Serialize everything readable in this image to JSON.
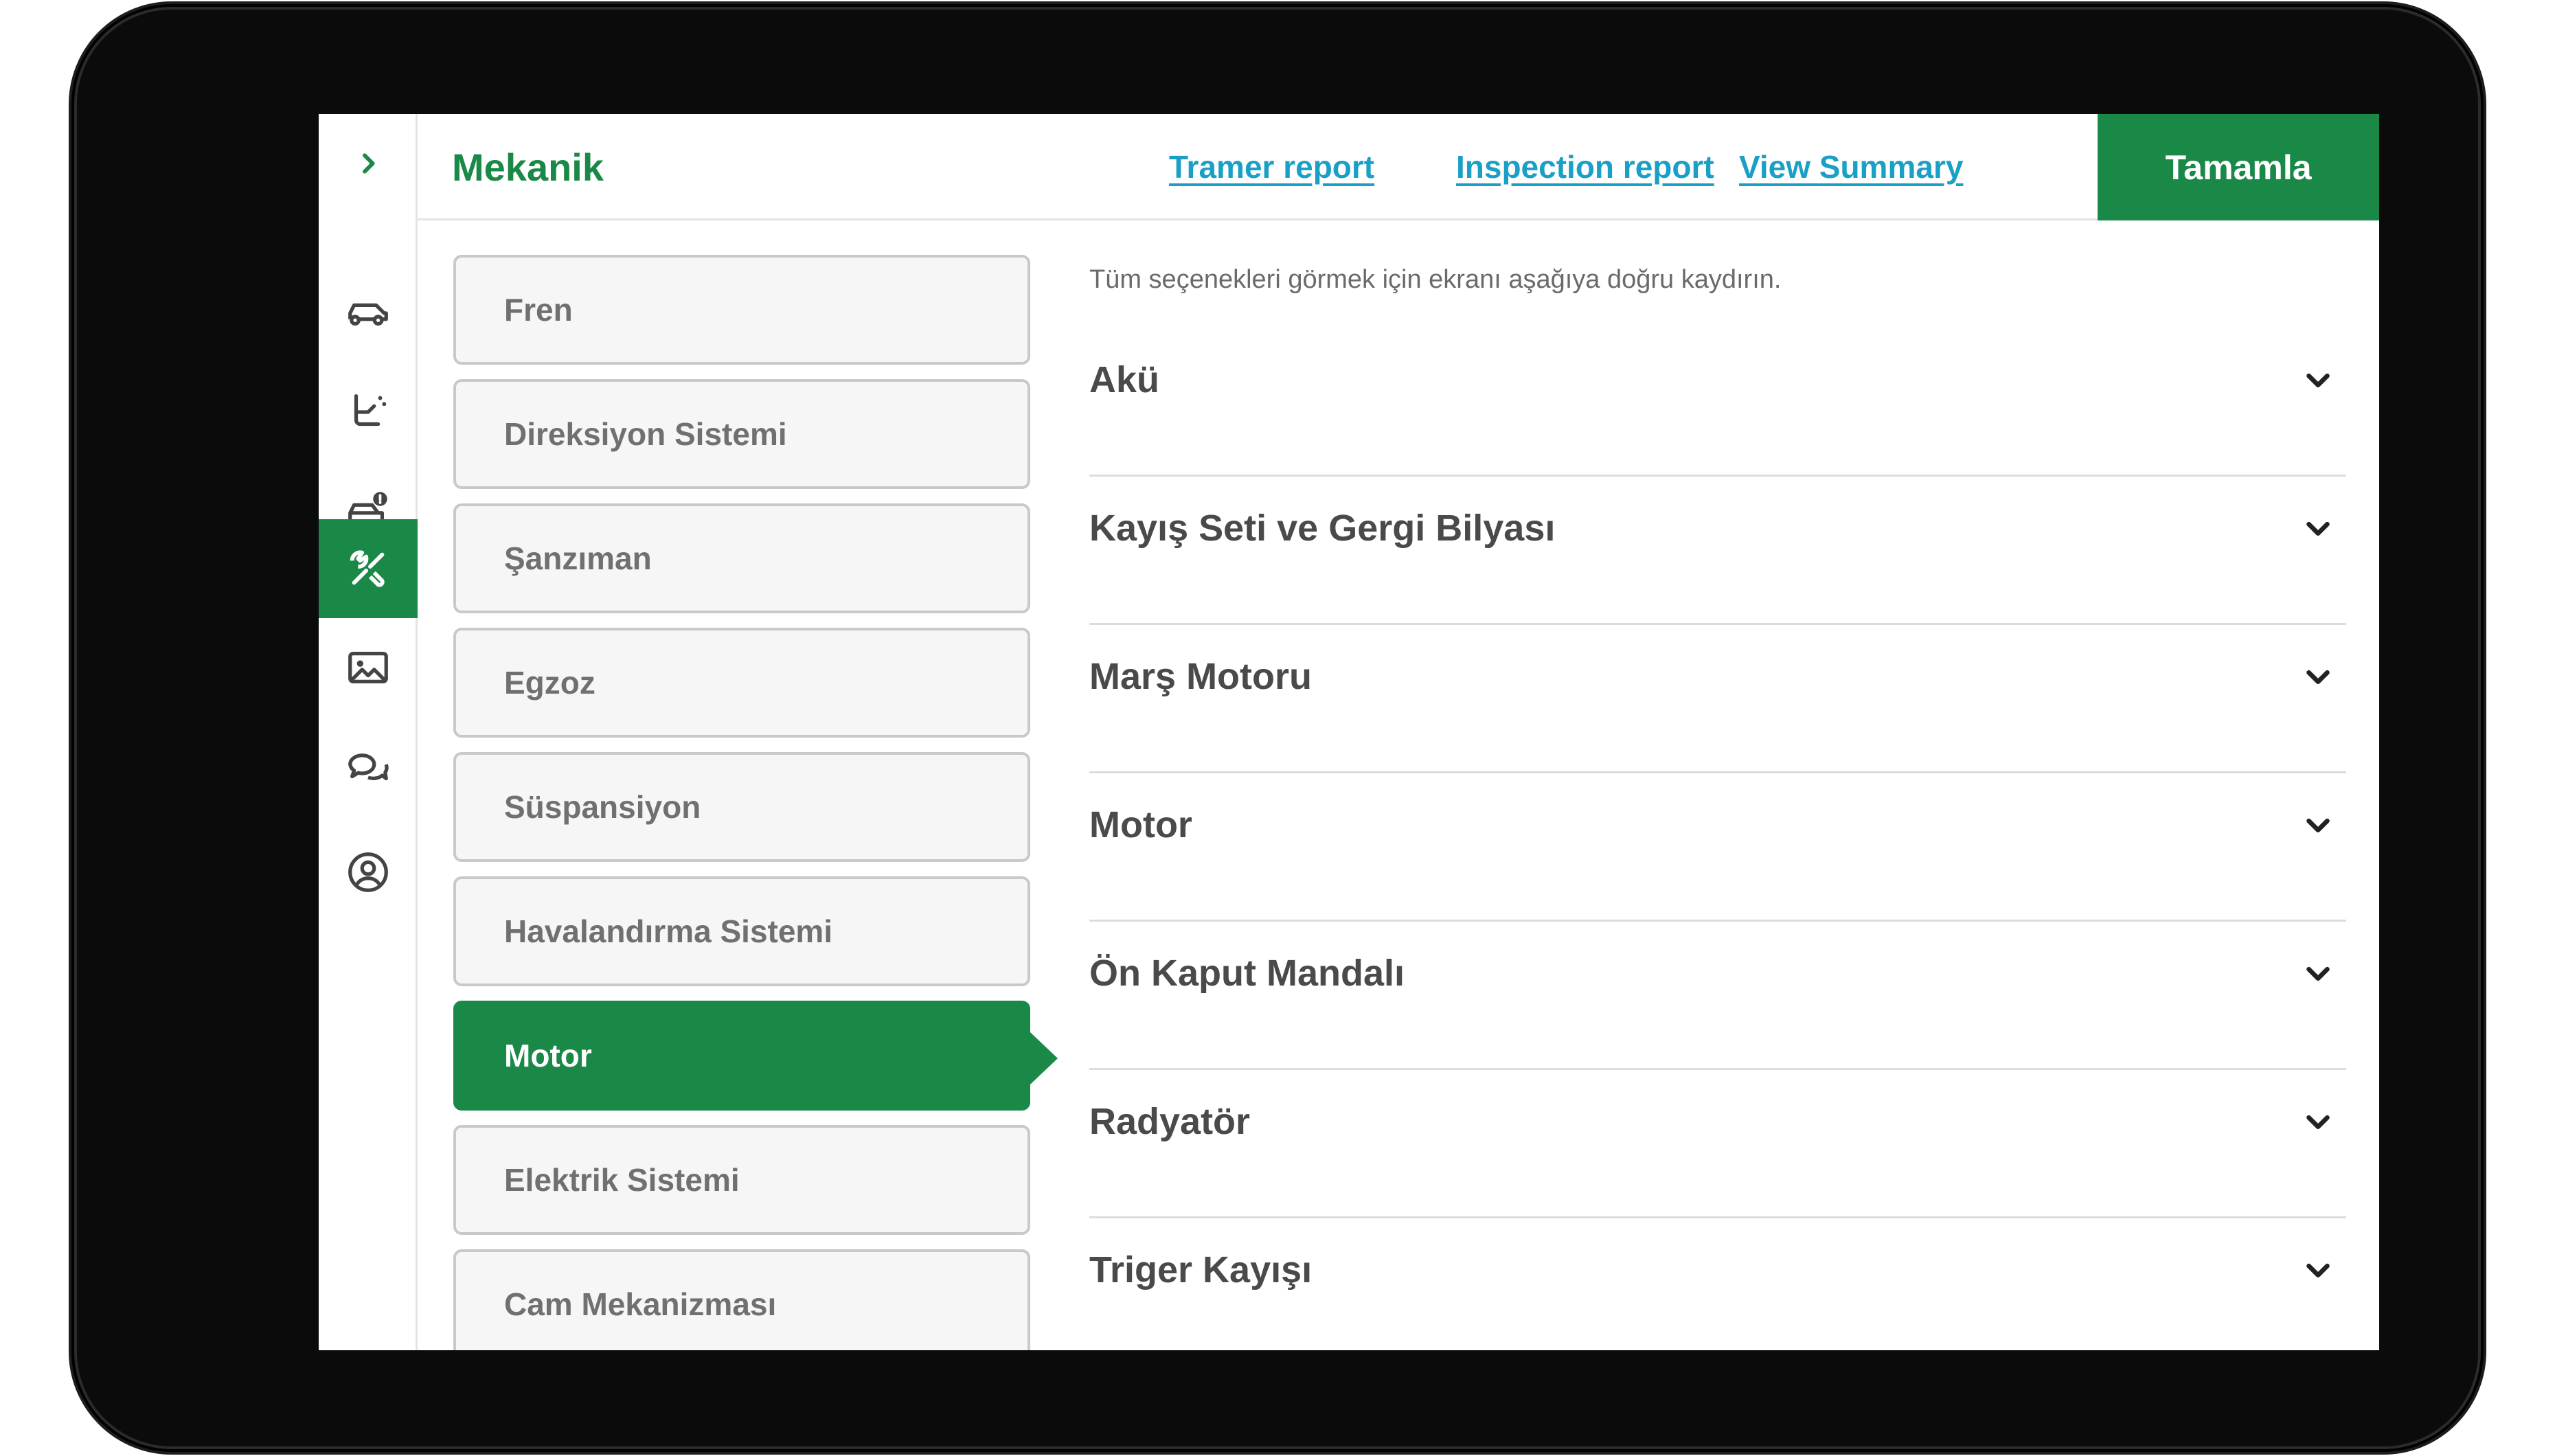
{
  "header": {
    "title": "Mekanik",
    "links": [
      "Tramer report",
      "Inspection report",
      "View Summary"
    ],
    "complete_label": "Tamamla"
  },
  "rail": {
    "expand_icon": "chevron-right-icon",
    "items": [
      {
        "icon": "car-icon",
        "active": false
      },
      {
        "icon": "car-seat-icon",
        "active": false
      },
      {
        "icon": "car-warning-icon",
        "active": false
      },
      {
        "icon": "tools-icon",
        "active": true
      },
      {
        "icon": "image-icon",
        "active": false
      },
      {
        "icon": "chat-icon",
        "active": false
      },
      {
        "icon": "user-icon",
        "active": false
      }
    ]
  },
  "categories": [
    {
      "label": "Fren",
      "active": false
    },
    {
      "label": "Direksiyon Sistemi",
      "active": false
    },
    {
      "label": "Şanzıman",
      "active": false
    },
    {
      "label": "Egzoz",
      "active": false
    },
    {
      "label": "Süspansiyon",
      "active": false
    },
    {
      "label": "Havalandırma Sistemi",
      "active": false
    },
    {
      "label": "Motor",
      "active": true
    },
    {
      "label": "Elektrik Sistemi",
      "active": false
    },
    {
      "label": "Cam Mekanizması",
      "active": false
    }
  ],
  "content": {
    "hint": "Tüm seçenekleri görmek için ekranı aşağıya doğru kaydırın.",
    "items": [
      "Akü",
      "Kayış Seti ve Gergi Bilyası",
      "Marş Motoru",
      "Motor",
      "Ön Kaput Mandalı",
      "Radyatör",
      "Triger Kayışı"
    ]
  },
  "colors": {
    "accent": "#1a8847",
    "link": "#1aa0c6",
    "text": "#4a4a4a",
    "muted": "#707070"
  }
}
